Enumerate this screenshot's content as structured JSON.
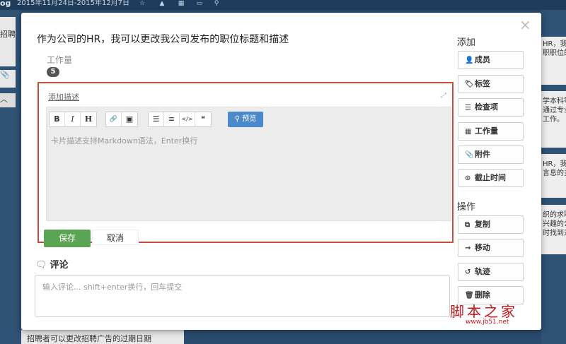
{
  "board": {
    "brand": "og",
    "date_range": "2015年11月24日-2015年12月7日",
    "left_cards": [
      "招聘",
      "",
      ""
    ],
    "right_cards": [
      "HR，我",
      "职职位的",
      "学本科等",
      "通过专业",
      "工作。",
      "HR，我",
      "言息的多",
      "织的求职",
      "兴趣的公",
      "时找到对"
    ],
    "bottom_card": "招聘者可以更改招聘广告的过期日期"
  },
  "card": {
    "title": "作为公司的HR，我可以更改我公司发布的职位标题和描述",
    "workload_label": "工作量",
    "workload_value": "5",
    "add_description_link": "添加描述",
    "editor_placeholder": "卡片描述支持Markdown语法，Enter换行",
    "preview_label": "预览",
    "save_label": "保存",
    "cancel_label": "取消",
    "comment_heading": "评论",
    "comment_placeholder": "输入评论... shift+enter换行，回车提交",
    "toolbar": {
      "bold": "B",
      "italic": "I",
      "heading": "H",
      "link": "🔗",
      "image": "▣",
      "bullet_list": "☰",
      "numbered_list": "≡",
      "code": "</>",
      "quote": "❝"
    }
  },
  "sidebar": {
    "add_title": "添加",
    "add_items": [
      {
        "label": "成员",
        "icon": "user-plus-icon",
        "glyph": "👤"
      },
      {
        "label": "标签",
        "icon": "tag-icon",
        "glyph": "🏷"
      },
      {
        "label": "检查项",
        "icon": "checklist-icon",
        "glyph": "☰"
      },
      {
        "label": "工作量",
        "icon": "grid-icon",
        "glyph": "▦"
      },
      {
        "label": "附件",
        "icon": "paperclip-icon",
        "glyph": "📎"
      },
      {
        "label": "截止时间",
        "icon": "clock-icon",
        "glyph": "⊙"
      }
    ],
    "actions_title": "操作",
    "action_items": [
      {
        "label": "复制",
        "icon": "copy-icon",
        "glyph": "⧉"
      },
      {
        "label": "移动",
        "icon": "arrow-right-icon",
        "glyph": "→"
      },
      {
        "label": "轨迹",
        "icon": "history-icon",
        "glyph": "↺"
      },
      {
        "label": "删除",
        "icon": "trash-icon",
        "glyph": "🗑"
      }
    ]
  },
  "watermark": {
    "text": "脚本之家",
    "url": "www.jb51.net"
  },
  "colors": {
    "highlight_border": "#c0503a",
    "save_green": "#5aa454",
    "preview_blue": "#4a8ac9"
  }
}
